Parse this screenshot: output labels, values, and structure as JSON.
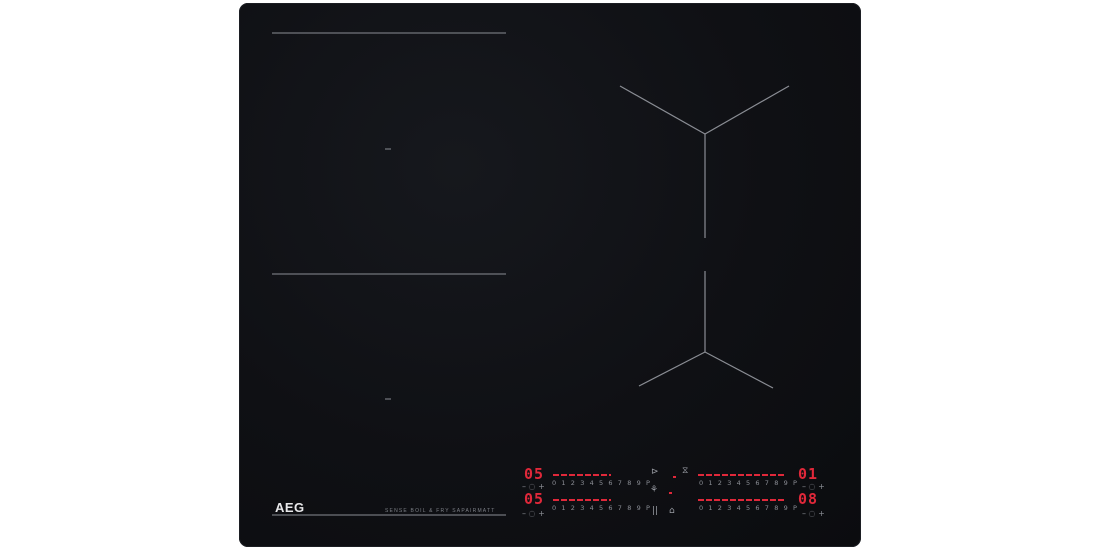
{
  "brand": "AEG",
  "tagline": "SENSE BOIL & FRY SAPAIRMATT",
  "zones": {
    "front_left": {
      "display": "05",
      "scale": "0 1 2 3 4 5 6 7 8 9 P"
    },
    "rear_left": {
      "display": "05",
      "scale": "0 1 2 3 4 5 6 7 8 9 P"
    },
    "rear_right": {
      "display": "01",
      "scale": "0 1 2 3 4 5 6 7 8 9 P"
    },
    "front_right": {
      "display": "08",
      "scale": "0 1 2 3 4 5 6 7 8 9 P"
    }
  },
  "controls": {
    "minus_plus": "– ◌ +",
    "center_top_left": "⊳",
    "center_top_right": "⧖",
    "center_mid": "⚘",
    "center_bottom_left": "||",
    "center_bottom_right": "⌂"
  },
  "colors": {
    "glass": "#0f1014",
    "display_red": "#e0283a",
    "zone_marking": "#8a8d94"
  }
}
